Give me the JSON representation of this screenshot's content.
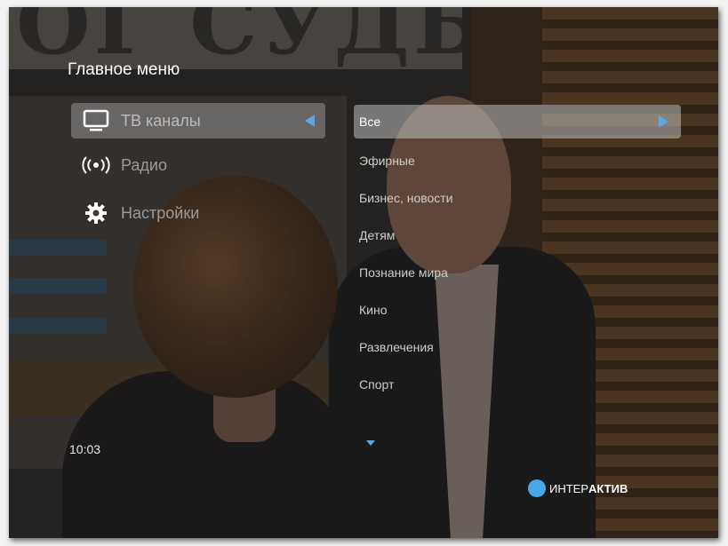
{
  "background": {
    "sign_text": "ОГ СУДЬБЫ"
  },
  "menu": {
    "title": "Главное меню",
    "main_items": [
      {
        "label": "ТВ каналы",
        "icon": "tv-icon",
        "selected": true
      },
      {
        "label": "Радио",
        "icon": "radio-icon",
        "selected": false
      },
      {
        "label": "Настройки",
        "icon": "gear-icon",
        "selected": false
      }
    ],
    "sub_items": [
      {
        "label": "Все",
        "selected": true
      },
      {
        "label": "Эфирные"
      },
      {
        "label": "Бизнес, новости"
      },
      {
        "label": "Детям"
      },
      {
        "label": "Познание мира"
      },
      {
        "label": "Кино"
      },
      {
        "label": "Развлечения"
      },
      {
        "label": "Спорт"
      }
    ]
  },
  "status": {
    "clock": "10:03",
    "interactive_prefix": "ИНТЕР",
    "interactive_suffix": "АКТИВ"
  },
  "colors": {
    "accent": "#5aa8e8",
    "blue_button": "#48a8e8"
  }
}
